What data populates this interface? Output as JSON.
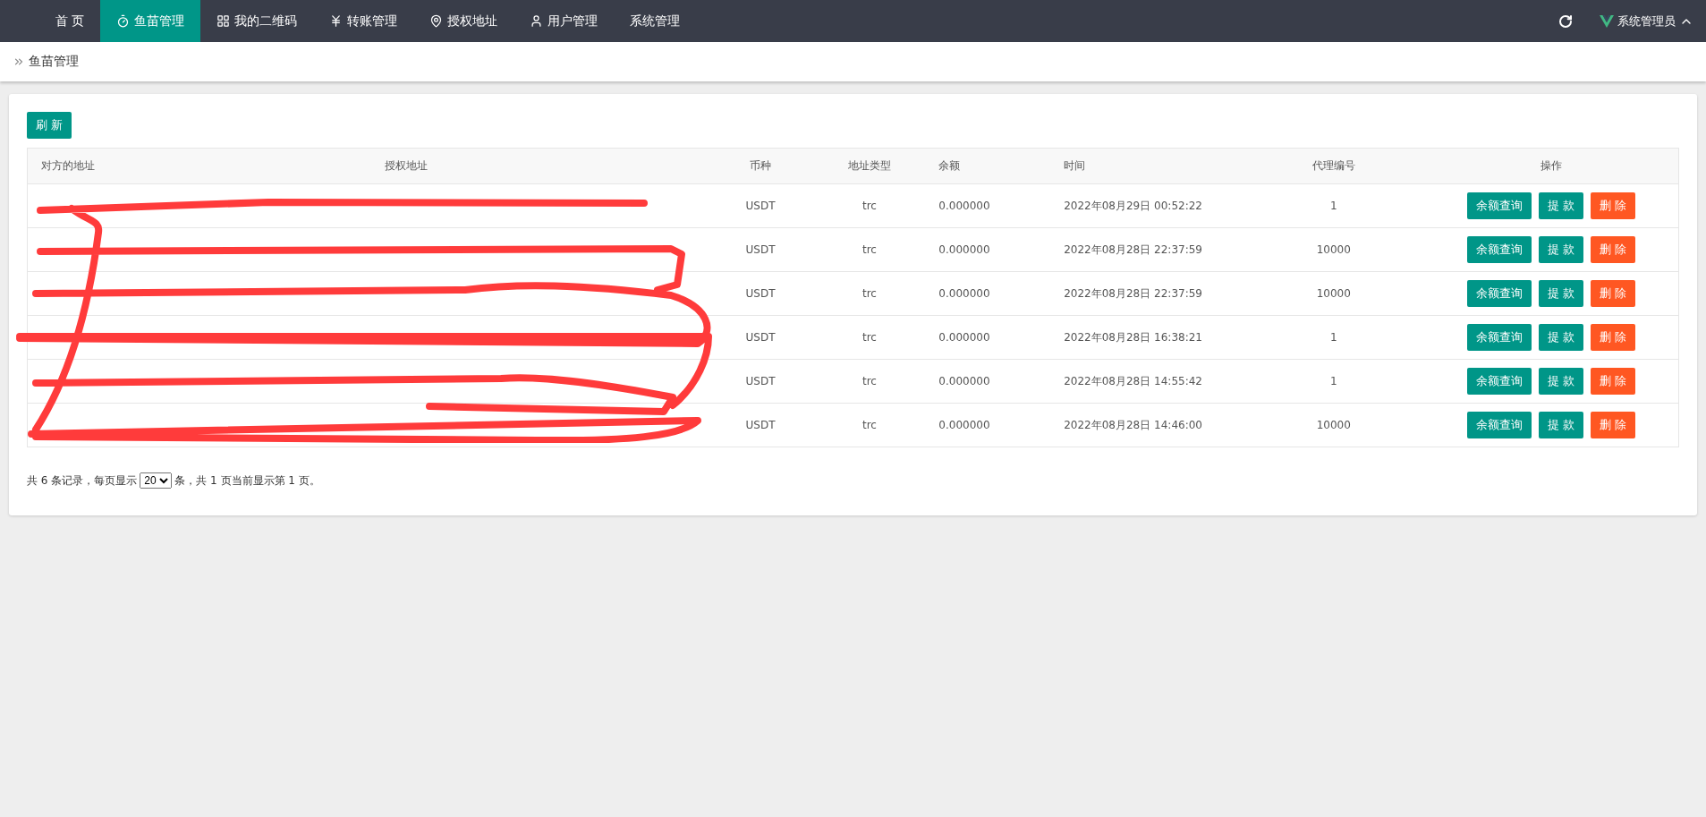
{
  "nav": {
    "items": [
      {
        "label": "首 页",
        "selected": false
      },
      {
        "label": "鱼苗管理",
        "selected": true
      },
      {
        "label": "我的二维码",
        "selected": false
      },
      {
        "label": "转账管理",
        "selected": false
      },
      {
        "label": "授权地址",
        "selected": false
      },
      {
        "label": "用户管理",
        "selected": false
      },
      {
        "label": "系统管理",
        "selected": false
      }
    ],
    "user": "系统管理员"
  },
  "breadcrumb": "鱼苗管理",
  "refresh_button": "刷 新",
  "table": {
    "columns": [
      "对方的地址",
      "授权地址",
      "币种",
      "地址类型",
      "余额",
      "时间",
      "代理编号",
      "操作"
    ],
    "rows": [
      {
        "currency": "USDT",
        "type": "trc",
        "balance": "0.000000",
        "time": "2022年08月29日 00:52:22",
        "agent": "1",
        "actions": [
          {
            "label": "余额查询",
            "kind": "primary"
          },
          {
            "label": "提 款",
            "kind": "primary"
          },
          {
            "label": "删 除",
            "kind": "danger"
          }
        ]
      },
      {
        "currency": "USDT",
        "type": "trc",
        "balance": "0.000000",
        "time": "2022年08月28日 22:37:59",
        "agent": "10000",
        "actions": [
          {
            "label": "余额查询",
            "kind": "primary"
          },
          {
            "label": "提 款",
            "kind": "primary"
          },
          {
            "label": "删 除",
            "kind": "danger"
          }
        ]
      },
      {
        "currency": "USDT",
        "type": "trc",
        "balance": "0.000000",
        "time": "2022年08月28日 22:37:59",
        "agent": "10000",
        "actions": [
          {
            "label": "余额查询",
            "kind": "primary"
          },
          {
            "label": "提 款",
            "kind": "primary"
          },
          {
            "label": "删 除",
            "kind": "danger"
          }
        ]
      },
      {
        "currency": "USDT",
        "type": "trc",
        "balance": "0.000000",
        "time": "2022年08月28日 16:38:21",
        "agent": "1",
        "actions": [
          {
            "label": "余额查询",
            "kind": "primary"
          },
          {
            "label": "提 款",
            "kind": "primary"
          },
          {
            "label": "删 除",
            "kind": "danger"
          }
        ]
      },
      {
        "currency": "USDT",
        "type": "trc",
        "balance": "0.000000",
        "time": "2022年08月28日 14:55:42",
        "agent": "1",
        "actions": [
          {
            "label": "余额查询",
            "kind": "primary"
          },
          {
            "label": "提 款",
            "kind": "primary"
          },
          {
            "label": "删 除",
            "kind": "danger"
          }
        ]
      },
      {
        "currency": "USDT",
        "type": "trc",
        "balance": "0.000000",
        "time": "2022年08月28日 14:46:00",
        "agent": "10000",
        "actions": [
          {
            "label": "余额查询",
            "kind": "primary"
          },
          {
            "label": "提 款",
            "kind": "primary"
          },
          {
            "label": "删 除",
            "kind": "danger"
          }
        ]
      }
    ]
  },
  "pagination": {
    "before": "共 6 条记录，每页显示",
    "page_size": "20",
    "after": "条，共 1 页当前显示第 1 页。"
  }
}
